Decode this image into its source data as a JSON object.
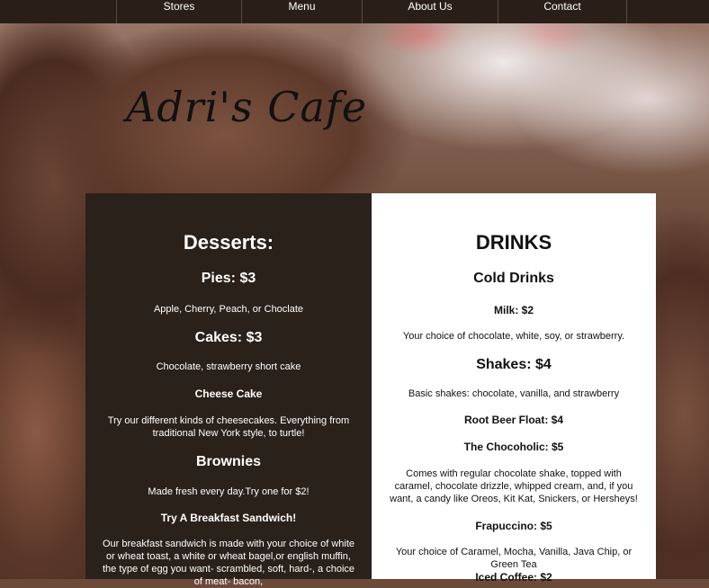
{
  "nav": {
    "items": [
      {
        "label": "Stores"
      },
      {
        "label": "Menu"
      },
      {
        "label": "About Us"
      },
      {
        "label": "Contact"
      }
    ]
  },
  "logo": "Adri's Cafe",
  "desserts": {
    "title": "Desserts:",
    "pies_title": "Pies: $3",
    "pies_desc": "Apple, Cherry, Peach, or Choclate",
    "cakes_title": "Cakes: $3",
    "cakes_desc": "Chocolate, strawberry short cake",
    "cheesecake_title": "Cheese Cake",
    "cheesecake_desc": "Try our different kinds of cheesecakes. Everything from traditional New York style, to turtle!",
    "brownies_title": "Brownies",
    "brownies_desc": "Made fresh every day.Try one for $2!",
    "breakfast_title": "Try A Breakfast Sandwich!",
    "breakfast_desc": "Our breakfast sandwich is made with your choice of white or wheat toast, a white or wheat bagel,or english muffin, the type of egg you want- scrambled, soft, hard-, a choice of meat- bacon,"
  },
  "drinks": {
    "title": "DRINKS",
    "cold_title": "Cold Drinks",
    "milk_title": "Milk: $2",
    "milk_desc": "Your choice of chocolate, white, soy, or strawberry.",
    "shakes_title": "Shakes: $4",
    "shakes_desc": "Basic shakes: chocolate, vanilla, and strawberry",
    "rootbeer_title": "Root Beer Float: $4",
    "chocoholic_title": "The Chocoholic: $5",
    "chocoholic_desc": "Comes with regular chocolate shake, topped with caramel, chocolate drizzle, whipped cream, and, if you want, a candy like Oreos, Kit Kat, Snickers, or Hersheys!",
    "frap_title": "Frapuccino: $5",
    "frap_desc": "Your choice of Caramel, Mocha, Vanilla, Java Chip, or Green Tea",
    "iced_title": "Iced Coffee: $2"
  }
}
